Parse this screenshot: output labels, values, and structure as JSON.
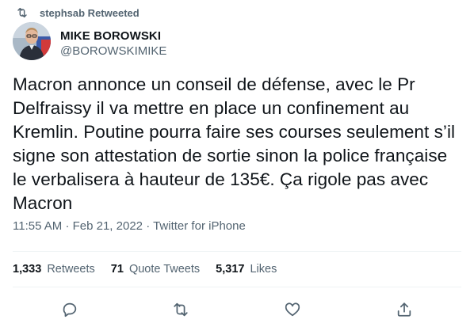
{
  "retweet_context": {
    "label": "stephsab Retweeted"
  },
  "author": {
    "display_name": "MIKE BOROWSKI",
    "handle": "@BOROWSKIMIKE"
  },
  "tweet": {
    "text": "Macron annonce un conseil de défense, avec le Pr Delfraissy il va mettre en place un confinement au Kremlin. Poutine pourra faire ses courses seulement s’il signe son attestation de sortie sinon la police française le verbalisera à hauteur de 135€. Ça rigole pas avec Macron",
    "time": "11:55 AM",
    "separator": "·",
    "date": "Feb 21, 2022",
    "source": "Twitter for iPhone"
  },
  "stats": {
    "retweets_count": "1,333",
    "retweets_label": "Retweets",
    "quotes_count": "71",
    "quotes_label": "Quote Tweets",
    "likes_count": "5,317",
    "likes_label": "Likes"
  },
  "actions": {
    "reply_icon": "reply-icon",
    "retweet_icon": "retweet-icon",
    "like_icon": "heart-icon",
    "share_icon": "share-icon"
  },
  "colors": {
    "text_primary": "#0f1419",
    "text_secondary": "#536471",
    "divider": "#eff3f4"
  }
}
